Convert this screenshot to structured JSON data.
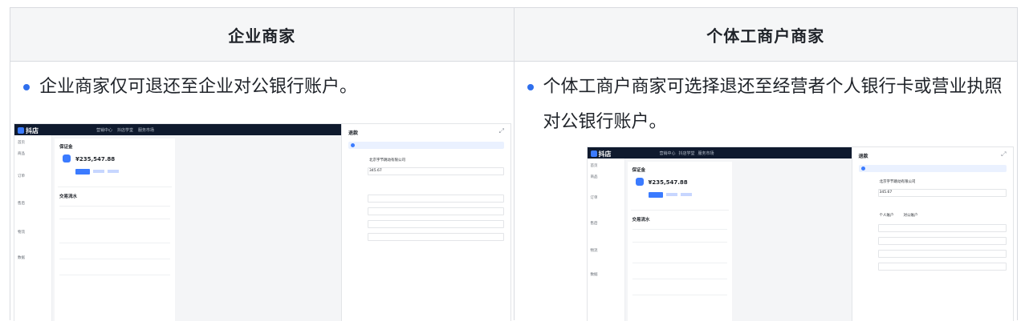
{
  "columns": [
    {
      "header": "企业商家",
      "bullet": "企业商家仅可退还至企业对公银行账户。"
    },
    {
      "header": "个体工商户商家",
      "bullet": "个体工商户商家可选择退还至经营者个人银行卡或营业执照对公银行账户。"
    }
  ],
  "screenshot": {
    "logo": "抖店",
    "nav": [
      "营销中心",
      "抖店学堂",
      "服务市场"
    ],
    "side_items": [
      "首页",
      "商品",
      "订单",
      "售后",
      "物流",
      "数据"
    ],
    "section_deposit": "保证金",
    "amount": "¥235,547.88",
    "section_flow": "交易流水",
    "panel_title": "退款",
    "account_name": "北京字节跳动有限公司",
    "refund_amount": "345.67",
    "account_type_personal": "个人账户",
    "account_type_public": "对公账户"
  },
  "colors": {
    "accent": "#2f6fed",
    "header_bg": "#f5f6f7",
    "border": "#d9dbe0"
  }
}
